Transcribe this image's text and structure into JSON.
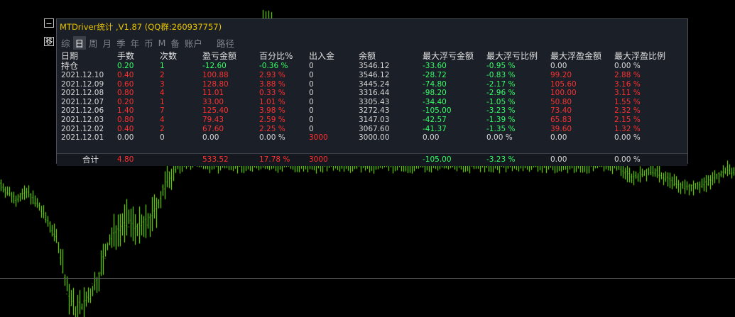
{
  "colors": {
    "background": "#000000",
    "candle": "#7CFC00",
    "panel_bg": "#1b1f27",
    "title": "#e8c300",
    "text": "#e0e0e0",
    "positive": "#ff3030",
    "negative": "#33ff66",
    "neutral": "#d8d8d8"
  },
  "buttons": {
    "minimize": "−",
    "move": "移"
  },
  "panel": {
    "title": "MTDriver统计 ,V1.87 (QQ群:260937757)",
    "tabs": [
      {
        "label": "综",
        "active": false
      },
      {
        "label": "日",
        "active": true
      },
      {
        "label": "周",
        "active": false
      },
      {
        "label": "月",
        "active": false
      },
      {
        "label": "季",
        "active": false
      },
      {
        "label": "年",
        "active": false
      },
      {
        "label": "币",
        "active": false
      },
      {
        "label": "M",
        "active": false
      },
      {
        "label": "备",
        "active": false
      },
      {
        "label": "账户",
        "active": false
      },
      {
        "label": "路径",
        "active": false
      }
    ],
    "headers": [
      "日期",
      "手数",
      "次数",
      "盈亏金额",
      "百分比%",
      "出入金",
      "余额",
      "最大浮亏金额",
      "最大浮亏比例",
      "最大浮盈金额",
      "最大浮盈比例"
    ],
    "rows": [
      {
        "cells": [
          "持仓",
          "0.20",
          "1",
          "-12.60",
          "-0.36 %",
          "0",
          "3546.12",
          "-33.60",
          "-0.95 %",
          "0.00",
          "0.00 %"
        ],
        "colors": [
          "hdr",
          "neg",
          "neg",
          "neg",
          "neg",
          "neu",
          "neu",
          "neg",
          "neg",
          "neu",
          "neu"
        ]
      },
      {
        "cells": [
          "2021.12.10",
          "0.40",
          "2",
          "100.88",
          "2.93 %",
          "0",
          "3546.12",
          "-28.72",
          "-0.83 %",
          "99.20",
          "2.88 %"
        ],
        "colors": [
          "neu",
          "pos",
          "pos",
          "pos",
          "pos",
          "neu",
          "neu",
          "neg",
          "neg",
          "pos",
          "pos"
        ]
      },
      {
        "cells": [
          "2021.12.09",
          "0.60",
          "3",
          "128.80",
          "3.88 %",
          "0",
          "3445.24",
          "-74.80",
          "-2.17 %",
          "105.60",
          "3.16 %"
        ],
        "colors": [
          "neu",
          "pos",
          "pos",
          "pos",
          "pos",
          "neu",
          "neu",
          "neg",
          "neg",
          "pos",
          "pos"
        ]
      },
      {
        "cells": [
          "2021.12.08",
          "0.80",
          "4",
          "11.01",
          "0.33 %",
          "0",
          "3316.44",
          "-98.20",
          "-2.96 %",
          "100.00",
          "3.11 %"
        ],
        "colors": [
          "neu",
          "pos",
          "pos",
          "pos",
          "pos",
          "neu",
          "neu",
          "neg",
          "neg",
          "pos",
          "pos"
        ]
      },
      {
        "cells": [
          "2021.12.07",
          "0.20",
          "1",
          "33.00",
          "1.01 %",
          "0",
          "3305.43",
          "-34.40",
          "-1.05 %",
          "50.80",
          "1.55 %"
        ],
        "colors": [
          "neu",
          "pos",
          "pos",
          "pos",
          "pos",
          "neu",
          "neu",
          "neg",
          "neg",
          "pos",
          "pos"
        ]
      },
      {
        "cells": [
          "2021.12.06",
          "1.40",
          "7",
          "125.40",
          "3.98 %",
          "0",
          "3272.43",
          "-105.00",
          "-3.23 %",
          "73.40",
          "2.32 %"
        ],
        "colors": [
          "neu",
          "pos",
          "pos",
          "pos",
          "pos",
          "neu",
          "neu",
          "neg",
          "neg",
          "pos",
          "pos"
        ]
      },
      {
        "cells": [
          "2021.12.03",
          "0.80",
          "4",
          "79.43",
          "2.59 %",
          "0",
          "3147.03",
          "-42.57",
          "-1.39 %",
          "65.83",
          "2.15 %"
        ],
        "colors": [
          "neu",
          "pos",
          "pos",
          "pos",
          "pos",
          "neu",
          "neu",
          "neg",
          "neg",
          "pos",
          "pos"
        ]
      },
      {
        "cells": [
          "2021.12.02",
          "0.40",
          "2",
          "67.60",
          "2.25 %",
          "0",
          "3067.60",
          "-41.37",
          "-1.35 %",
          "39.60",
          "1.32 %"
        ],
        "colors": [
          "neu",
          "pos",
          "pos",
          "pos",
          "pos",
          "neu",
          "neu",
          "neg",
          "neg",
          "pos",
          "pos"
        ]
      },
      {
        "cells": [
          "2021.12.01",
          "0.00",
          "0",
          "0.00",
          "0.00 %",
          "3000",
          "3000.00",
          "0.00",
          "0.00 %",
          "0.00",
          "0.00 %"
        ],
        "colors": [
          "neu",
          "neu",
          "neu",
          "neu",
          "neu",
          "pos",
          "neu",
          "neu",
          "neu",
          "neu",
          "neu"
        ]
      }
    ],
    "total": {
      "cells": [
        "合计",
        "4.80",
        "",
        "533.52",
        "17.78 %",
        "3000",
        "",
        "-105.00",
        "-3.23 %",
        "0.00",
        "0.00 %"
      ],
      "colors": [
        "neu",
        "pos",
        "neu",
        "pos",
        "pos",
        "pos",
        "neu",
        "neg",
        "neg",
        "neu",
        "neu"
      ]
    }
  }
}
